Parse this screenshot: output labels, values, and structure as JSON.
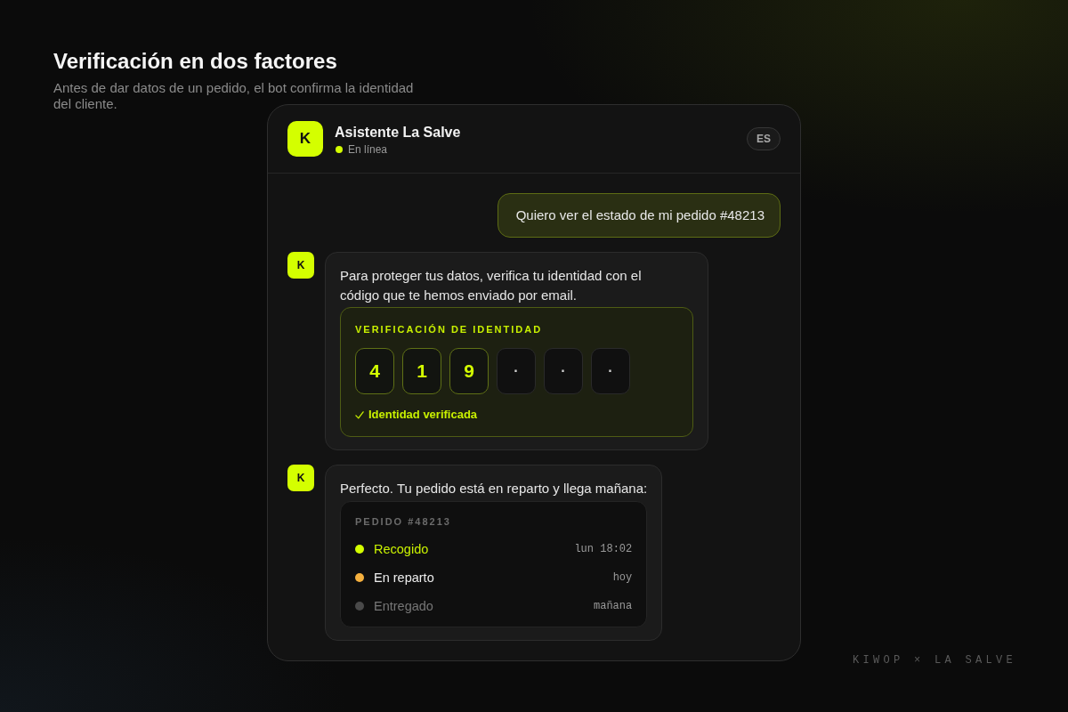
{
  "heading": {
    "title": "Verificación en dos factores",
    "subtitle": "Antes de dar datos de un pedido, el bot confirma la identidad del cliente."
  },
  "chat": {
    "header": {
      "avatar": "K",
      "name": "Asistente La Salve",
      "status": {
        "label": "En línea",
        "online": true
      },
      "language": "ES"
    },
    "messages": [
      {
        "kind": "user",
        "text": "Quiero ver el estado de mi pedido #48213"
      },
      {
        "kind": "bot",
        "avatar": "K",
        "text": "Para proteger tus datos, verifica tu identidad con el código que te hemos enviado por email.",
        "card": {
          "kind": "verification",
          "title": "VERIFICACIÓN DE IDENTIDAD",
          "digits": [
            {
              "value": "4",
              "filled": true
            },
            {
              "value": "1",
              "filled": true
            },
            {
              "value": "9",
              "filled": true
            },
            {
              "value": "·",
              "filled": false
            },
            {
              "value": "·",
              "filled": false
            },
            {
              "value": "·",
              "filled": false
            }
          ],
          "result": {
            "verified": true,
            "label": "Identidad verificada"
          }
        }
      },
      {
        "kind": "bot",
        "avatar": "K",
        "text": "Perfecto. Tu pedido está en reparto y llega mañana:",
        "card": {
          "kind": "order",
          "title": "PEDIDO #48213",
          "steps": [
            {
              "label": "Recogido",
              "time": "lun 18:02",
              "done": true,
              "active": false,
              "color": "#d4ff00"
            },
            {
              "label": "En reparto",
              "time": "hoy",
              "done": false,
              "active": true,
              "color": "#f5b03e"
            },
            {
              "label": "Entregado",
              "time": "mañana",
              "done": false,
              "active": false,
              "color": "#4a4a4a"
            }
          ]
        }
      }
    ]
  },
  "footer": "KIWOP × LA SALVE"
}
